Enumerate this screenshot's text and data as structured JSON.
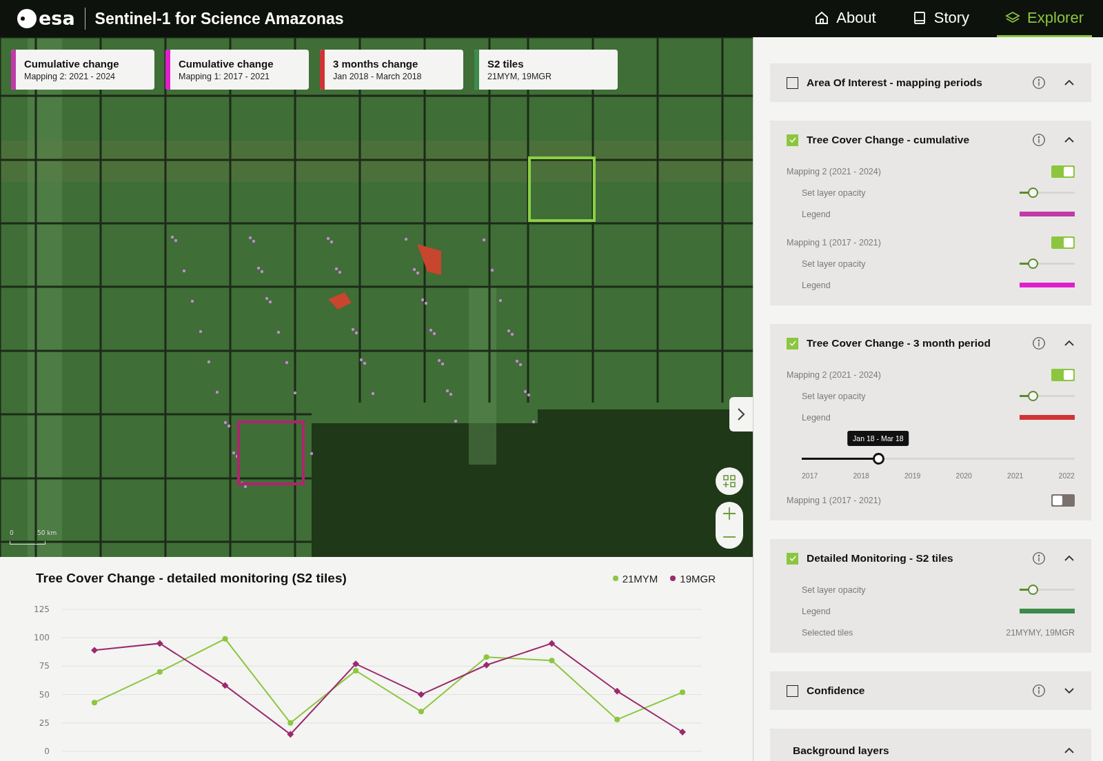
{
  "header": {
    "logo": "esa",
    "title": "Sentinel-1 for Science Amazonas"
  },
  "nav": [
    {
      "label": "About",
      "selected": false
    },
    {
      "label": "Story",
      "selected": false
    },
    {
      "label": "Explorer",
      "selected": true
    }
  ],
  "map": {
    "cards": [
      {
        "title": "Cumulative change",
        "subtitle": "Mapping 2: 2021 - 2024",
        "color": "#c03aa8"
      },
      {
        "title": "Cumulative change",
        "subtitle": "Mapping 1: 2017 - 2021",
        "color": "#e01fcc"
      },
      {
        "title": "3 months change",
        "subtitle": "Jan 2018 - March 2018",
        "color": "#d03434"
      },
      {
        "title": "S2 tiles",
        "subtitle": "21MYM, 19MGR",
        "color": "#3d8a4c"
      }
    ],
    "scale": {
      "start": "0",
      "end": "50 km"
    }
  },
  "chart_panel": {
    "chart_data": {
      "type": "line",
      "title": "Tree Cover Change - detailed monitoring (S2 tiles)",
      "ylim": [
        0,
        125
      ],
      "yticks": [
        0,
        25,
        50,
        75,
        100,
        125
      ],
      "grid": true,
      "series": [
        {
          "name": "21MYM",
          "color": "#8cc63f",
          "marker": "circle",
          "values": [
            43,
            70,
            99,
            25,
            71,
            35,
            83,
            80,
            28,
            52
          ]
        },
        {
          "name": "19MGR",
          "color": "#9b2a6e",
          "marker": "diamond",
          "values": [
            89,
            95,
            58,
            15,
            77,
            50,
            76,
            95,
            53,
            17
          ]
        }
      ]
    }
  },
  "sidebar": {
    "sections": [
      {
        "kind": "layer",
        "title": "Area Of Interest - mapping periods",
        "checked": false,
        "expanded": true
      },
      {
        "kind": "layer",
        "title": "Tree Cover Change - cumulative",
        "checked": true,
        "expanded": true,
        "rows": [
          {
            "kind": "toggle",
            "label": "Mapping 2 (2021 - 2024)",
            "on": true
          },
          {
            "kind": "opacity",
            "label": "Set layer opacity",
            "level": 0.2
          },
          {
            "kind": "legend",
            "label": "Legend",
            "color": "#c03aa8"
          },
          {
            "kind": "toggle",
            "label": "Mapping 1 (2017 - 2021)",
            "on": true
          },
          {
            "kind": "opacity",
            "label": "Set layer opacity",
            "level": 0.2
          },
          {
            "kind": "legend",
            "label": "Legend",
            "color": "#e01fcc"
          }
        ]
      },
      {
        "kind": "layer",
        "title": "Tree Cover Change - 3 month period",
        "checked": true,
        "expanded": true,
        "rows": [
          {
            "kind": "toggle",
            "label": "Mapping 2 (2021 - 2024)",
            "on": true
          },
          {
            "kind": "opacity",
            "label": "Set layer opacity",
            "level": 0.2
          },
          {
            "kind": "legend",
            "label": "Legend",
            "color": "#d03434"
          },
          {
            "kind": "timeline",
            "tooltip": "Jan 18 - Mar 18",
            "level": 0.28,
            "ticks": [
              "2017",
              "2018",
              "2019",
              "2020",
              "2021",
              "2022"
            ]
          },
          {
            "kind": "toggle",
            "label": "Mapping 1 (2017 - 2021)",
            "on": false
          }
        ]
      },
      {
        "kind": "layer",
        "title": "Detailed Monitoring - S2 tiles",
        "checked": true,
        "expanded": true,
        "rows": [
          {
            "kind": "opacity",
            "label": "Set layer opacity",
            "level": 0.2
          },
          {
            "kind": "legend",
            "label": "Legend",
            "color": "#3d8a4c"
          },
          {
            "kind": "value",
            "label": "Selected tiles",
            "value": "21MYMY, 19MGR"
          }
        ]
      },
      {
        "kind": "layer",
        "title": "Confidence",
        "checked": false,
        "expanded": false
      },
      {
        "kind": "group",
        "title": "Background layers",
        "expanded": true
      }
    ]
  }
}
